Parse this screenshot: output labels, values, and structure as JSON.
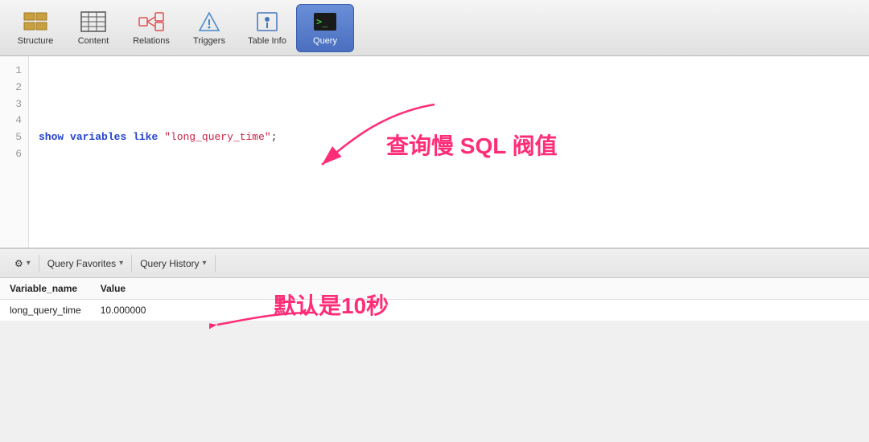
{
  "toolbar": {
    "items": [
      {
        "id": "structure",
        "label": "Structure",
        "active": false
      },
      {
        "id": "content",
        "label": "Content",
        "active": false
      },
      {
        "id": "relations",
        "label": "Relations",
        "active": false
      },
      {
        "id": "triggers",
        "label": "Triggers",
        "active": false
      },
      {
        "id": "tableinfo",
        "label": "Table Info",
        "active": false
      },
      {
        "id": "query",
        "label": "Query",
        "active": true
      }
    ]
  },
  "editor": {
    "lines": [
      "",
      "",
      "",
      "",
      "show variables like \"long_query_time\";",
      ""
    ]
  },
  "annotation_top": {
    "text": "查询慢 SQL 阀值"
  },
  "bottom_toolbar": {
    "gear_label": "⚙",
    "favorites_label": "Query Favorites",
    "history_label": "Query History",
    "chevron": "▾"
  },
  "results": {
    "columns": [
      "Variable_name",
      "Value"
    ],
    "rows": [
      [
        "long_query_time",
        "10.000000"
      ]
    ]
  },
  "annotation_bottom": {
    "text": "默认是10秒"
  }
}
